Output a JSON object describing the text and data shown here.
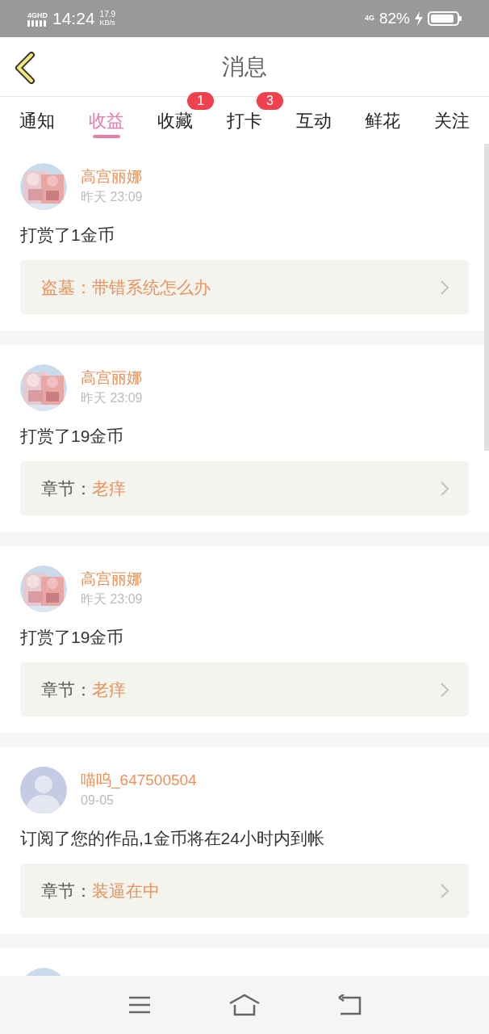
{
  "status_bar": {
    "network": "4GHD",
    "time": "14:24",
    "speed_value": "17.9",
    "speed_unit": "KB/s",
    "network_right": "4G",
    "battery": "82%"
  },
  "header": {
    "title": "消息"
  },
  "tabs": [
    {
      "label": "通知",
      "selected": false
    },
    {
      "label": "收益",
      "selected": true
    },
    {
      "label": "收藏",
      "selected": false,
      "badge": "1"
    },
    {
      "label": "打卡",
      "selected": false,
      "badge": "3"
    },
    {
      "label": "互动",
      "selected": false
    },
    {
      "label": "鲜花",
      "selected": false
    },
    {
      "label": "关注",
      "selected": false
    }
  ],
  "messages": [
    {
      "avatar": {
        "kind": "picture"
      },
      "name": "高宫丽娜",
      "time": "昨天 23:09",
      "text": "打赏了1金币",
      "link": {
        "label": "盗墓：",
        "title": "带错系统怎么办",
        "label_highlighted": true
      }
    },
    {
      "avatar": {
        "kind": "picture"
      },
      "name": "高宫丽娜",
      "time": "昨天 23:09",
      "text": "打赏了19金币",
      "link": {
        "label": "章节：",
        "title": "老痒",
        "label_highlighted": false
      }
    },
    {
      "avatar": {
        "kind": "picture"
      },
      "name": "高宫丽娜",
      "time": "昨天 23:09",
      "text": "打赏了19金币",
      "link": {
        "label": "章节：",
        "title": "老痒",
        "label_highlighted": false
      }
    },
    {
      "avatar": {
        "kind": "default"
      },
      "name": "喵呜_647500504",
      "time": "09-05",
      "text": "订阅了您的作品,1金币将在24小时内到帐",
      "link": {
        "label": "章节：",
        "title": "装逼在中",
        "label_highlighted": false
      }
    },
    {
      "avatar": {
        "kind": "picture"
      }
    }
  ]
}
